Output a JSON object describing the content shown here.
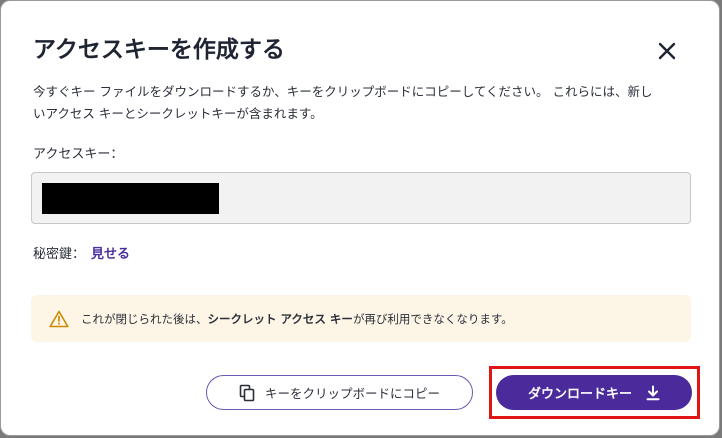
{
  "dialog": {
    "title": "アクセスキーを作成する",
    "description": "今すぐキー ファイルをダウンロードするか、キーをクリップボードにコピーしてください。 これらには、新しいアクセス キーとシークレットキーが含まれます。",
    "access_key_label": "アクセスキー：",
    "secret_key_label": "秘密鍵：",
    "show_link": "見せる",
    "warning": {
      "prefix": "これが閉じられた後は、",
      "emphasis": "シークレット アクセス キー",
      "suffix": "が再び利用できなくなります。"
    },
    "copy_button": "キーをクリップボードにコピー",
    "download_button": "ダウンロードキー"
  },
  "colors": {
    "accent": "#4b2a9c",
    "warning_bg": "#fdf6e6",
    "warning_icon": "#c98a00",
    "highlight": "#e01515"
  },
  "icons": {
    "close": "close-icon",
    "warning": "warning-icon",
    "copy": "copy-icon",
    "download": "download-icon"
  }
}
